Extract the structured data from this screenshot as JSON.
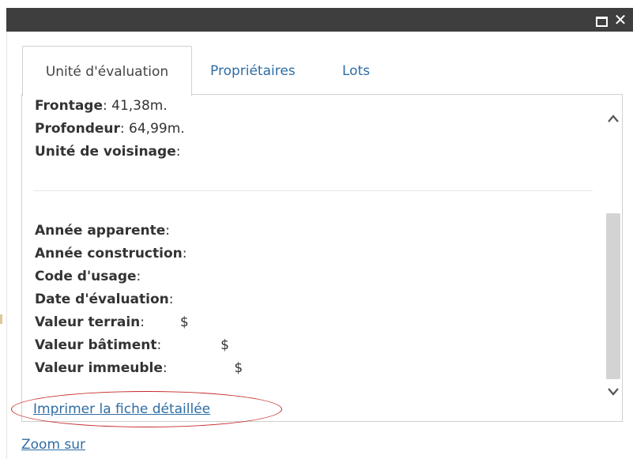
{
  "titlebar": {
    "maximize_icon": "maximize-icon",
    "close_icon": "close-icon",
    "close_glyph": "✕"
  },
  "tabs": [
    {
      "label": "Unité d'évaluation",
      "active": true
    },
    {
      "label": "Propriétaires",
      "active": false
    },
    {
      "label": "Lots",
      "active": false
    }
  ],
  "panel": {
    "lines_top": [
      {
        "label": "Frontage",
        "value": "41,38m."
      },
      {
        "label": "Profondeur",
        "value": "64,99m."
      },
      {
        "label": "Unité de voisinage",
        "value": ""
      }
    ],
    "lines_bottom": [
      {
        "label": "Année apparente",
        "value": "",
        "currency": ""
      },
      {
        "label": "Année construction",
        "value": "",
        "currency": ""
      },
      {
        "label": "Code d'usage",
        "value": "",
        "currency": ""
      },
      {
        "label": "Date d'évaluation",
        "value": "",
        "currency": ""
      },
      {
        "label": "Valeur terrain",
        "value": "",
        "currency": "$"
      },
      {
        "label": "Valeur bâtiment",
        "value": "",
        "currency": "$"
      },
      {
        "label": "Valeur immeuble",
        "value": "",
        "currency": "$"
      }
    ],
    "label_suffix": ":",
    "print_link": "Imprimer la fiche détaillée"
  },
  "footer": {
    "zoom_link": "Zoom sur"
  },
  "colors": {
    "titlebar": "#3e3e3e",
    "link": "#2e6da4",
    "annotation": "#c62828"
  }
}
